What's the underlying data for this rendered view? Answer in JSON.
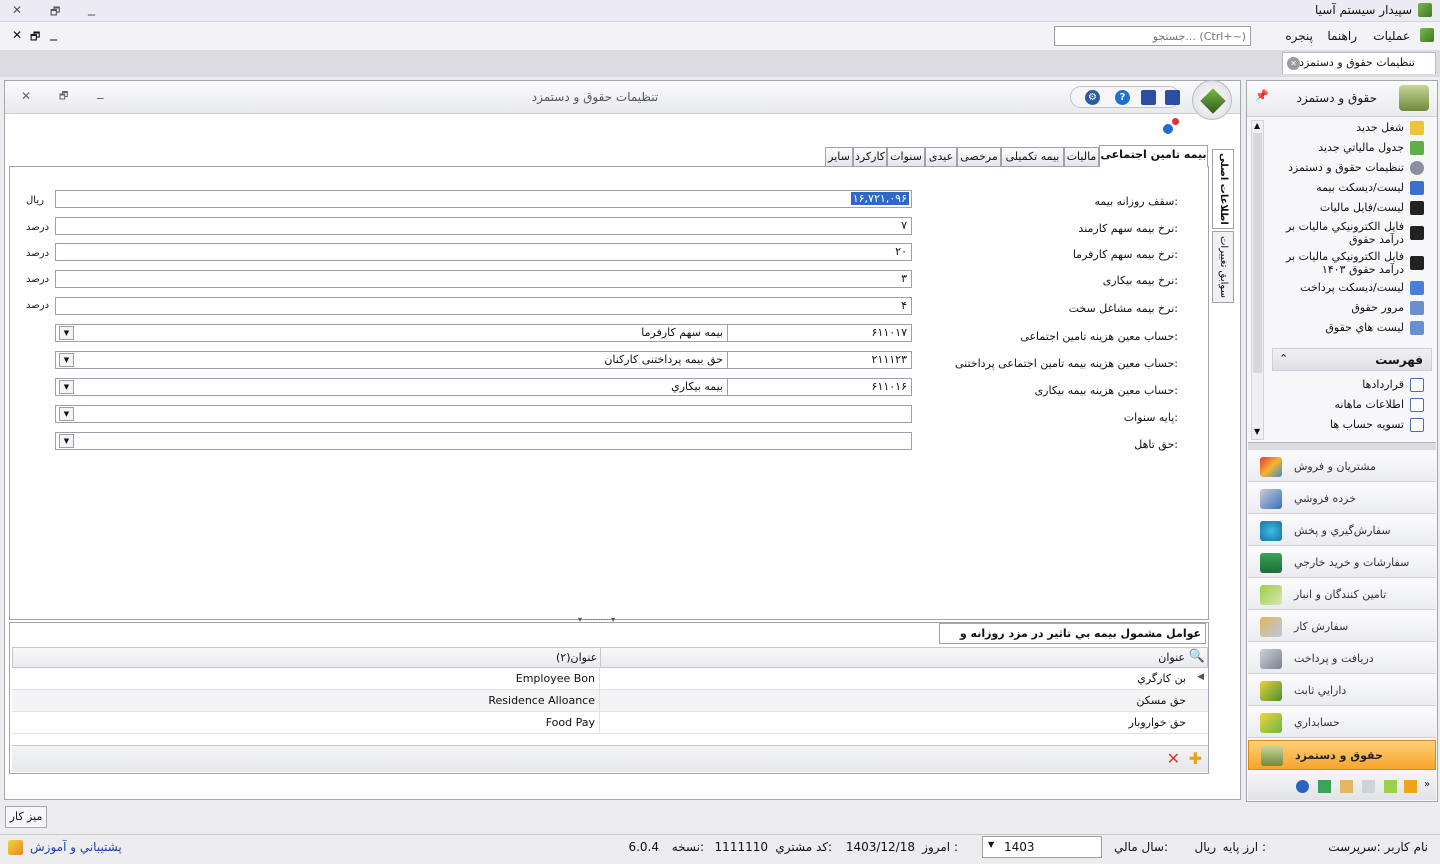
{
  "app_title": "سپيدار سيستم آسيا",
  "menu": {
    "operations": "عمليات",
    "help": "راهنما",
    "window": "پنجره",
    "search_placeholder": "جستجو... (Ctrl+~)"
  },
  "doc_tab": "تنظیمات حقوق و دستمزد",
  "form_title": "تنظیمات حقوق و دستمزد",
  "tabs": [
    "بیمه تامین اجتماعی",
    "مالیات",
    "بیمه تکمیلی",
    "مرخصی",
    "عیدی",
    "سنوات",
    "کارکرد",
    "سایر"
  ],
  "vtabs": [
    "اطلاعات اصلی",
    "سوابق تغییرات"
  ],
  "fields": [
    {
      "label": "سقف روزانه بیمه:",
      "value": "۱۶,۷۲۱,۰۹۶",
      "unit": "ريال"
    },
    {
      "label": "نرخ بیمه سهم کارمند:",
      "value": "۷",
      "unit": "درصد"
    },
    {
      "label": "نرخ بیمه سهم کارفرما:",
      "value": "۲۰",
      "unit": "درصد"
    },
    {
      "label": "نرخ بیمه بیکاری:",
      "value": "۳",
      "unit": "درصد"
    },
    {
      "label": "نرخ بیمه مشاغل سخت:",
      "value": "۴",
      "unit": "درصد"
    }
  ],
  "accounts": [
    {
      "label": "حساب معین هزینه تامین اجتماعی:",
      "code": "۶۱۱۰۱۷",
      "name": "بیمه سهم کارفرما"
    },
    {
      "label": "حساب معین هزینه بیمه تامین اجتماعی پرداختنی:",
      "code": "۲۱۱۱۲۳",
      "name": "حق بیمه پرداختنی کارکنان"
    },
    {
      "label": "حساب معین هزینه بیمه بیکاری:",
      "code": "۶۱۱۰۱۶",
      "name": "بیمه بیکاري"
    },
    {
      "label": "پایه سنوات:",
      "code": "",
      "name": ""
    },
    {
      "label": "حق تاهل:",
      "code": "",
      "name": ""
    }
  ],
  "grid": {
    "tab": "عوامل مشمول بیمه بي تاثیر در مزد روزانه و ماهانه",
    "col1": "عنوان",
    "col2": "عنوان(۲)",
    "rows": [
      {
        "title": "بن کارگري",
        "title2": "Employee Bon"
      },
      {
        "title": "حق مسکن",
        "title2": "Residence Alloance"
      },
      {
        "title": "حق خواروبار",
        "title2": "Food Pay"
      }
    ]
  },
  "sidebar": {
    "header": "حقوق و دستمزد",
    "items": [
      "شغل جديد",
      "جدول مالياتي جديد",
      "تنظیمات حقوق و دستمزد",
      "ليست/ديسكت بیمه",
      "ليست/فايل ماليات",
      "فايل الكترونيكي ماليات بر درآمد حقوق",
      "فايل الكترونيكي ماليات بر درآمد حقوق ۱۴۰۳",
      "ليست/ديسكت پرداخت",
      "مرور حقوق",
      "ليست هاي حقوق"
    ],
    "list_header": "فهرست",
    "list_items": [
      "قراردادها",
      "اطلاعات ماهانه",
      "تسويه حساب ها"
    ],
    "modules": [
      "مشتريان و فروش",
      "خرده فروشي",
      "سفارش‌گيري و پخش",
      "سفارشات و خريد خارجي",
      "تامين كنندگان و انبار",
      "سفارش کار",
      "دريافت و پرداخت",
      "دارايي ثابت",
      "حسابداري",
      "حقوق و دستمزد"
    ]
  },
  "desk": "میز کار",
  "status": {
    "user": "نام کاربر :سرپرست",
    "base_currency_label": "ارز پایه :",
    "base_currency": "ريال",
    "fiscal_year_label": "سال مالي:",
    "fiscal_year": "1403",
    "today_label": "امروز :",
    "today": "1403/12/18",
    "customer_label": "کد مشتري:",
    "customer": "1111110",
    "version_label": "نسخه:",
    "version": "6.0.4",
    "support": "پشتيباني و آموزش"
  }
}
